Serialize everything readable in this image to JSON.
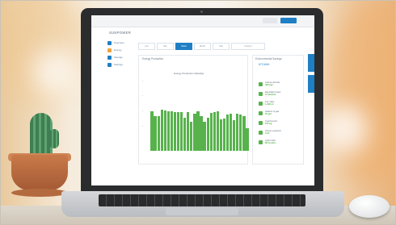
{
  "screen": {
    "logo": "SUNPOWER",
    "sidebar": [
      {
        "label": "Overview",
        "icon": "home-icon"
      },
      {
        "label": "Energy",
        "icon": "bolt-icon"
      },
      {
        "label": "Savings",
        "icon": "coin-icon"
      },
      {
        "label": "Settings",
        "icon": "gear-icon"
      }
    ],
    "tabs": [
      "Live",
      "Day",
      "Week",
      "Month",
      "Year",
      "Custom"
    ],
    "active_tab": "Week",
    "panel_left_title": "Energy Production",
    "chart_title": "Energy Production (Weekly)",
    "panel_right_title": "Environmental Savings",
    "summary_value": "673 kWh"
  },
  "colors": {
    "bar": "#57b24c",
    "accent": "#1f7fc4",
    "screen_bg": "#ffffff"
  },
  "chart_data": {
    "type": "bar",
    "title": "",
    "values": [
      70,
      62,
      61,
      73,
      72,
      70,
      70,
      68,
      68,
      68,
      58,
      68,
      52,
      66,
      70,
      62,
      52,
      58,
      67,
      69,
      70,
      56,
      57,
      64,
      66,
      54,
      66,
      64,
      62,
      40
    ],
    "ylim": [
      0,
      100
    ]
  },
  "stats": [
    {
      "label": "Carbon dioxide",
      "value": "490 kgs"
    },
    {
      "label": "Equivalent trees",
      "value": "12 planted"
    },
    {
      "label": "Car miles",
      "value": "1,028 mi"
    },
    {
      "label": "Gallons of gas",
      "value": "55 gal"
    },
    {
      "label": "Coal burned",
      "value": "245 kg"
    },
    {
      "label": "Homes powered",
      "value": "0.25"
    },
    {
      "label": "Light bulbs",
      "value": "68 months"
    }
  ]
}
